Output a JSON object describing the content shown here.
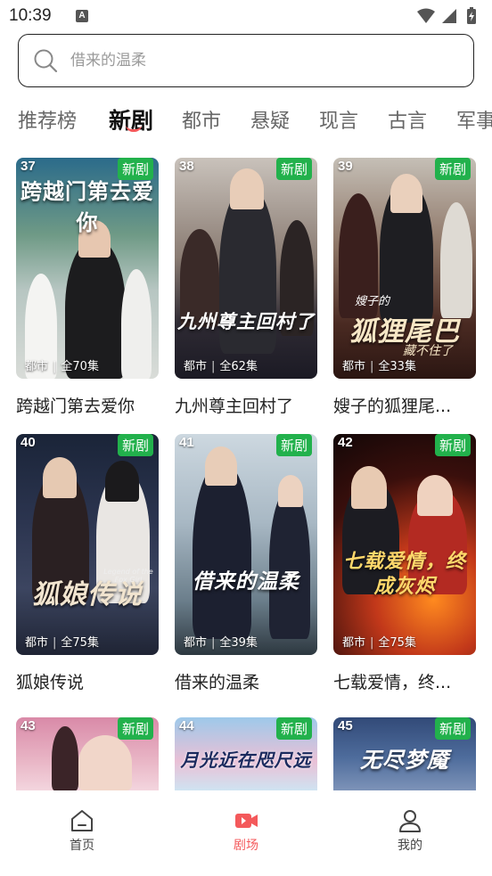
{
  "status": {
    "time": "10:39",
    "a_icon": "A"
  },
  "search": {
    "placeholder": "借来的温柔"
  },
  "tabs": [
    {
      "label": "推荐榜",
      "active": false
    },
    {
      "label": "新剧",
      "active": true
    },
    {
      "label": "都市",
      "active": false
    },
    {
      "label": "悬疑",
      "active": false
    },
    {
      "label": "现言",
      "active": false
    },
    {
      "label": "古言",
      "active": false
    },
    {
      "label": "军事",
      "active": false
    }
  ],
  "cards": [
    {
      "num": "37",
      "badge": "新剧",
      "poster_title": "跨越门第去爱你",
      "genre": "都市",
      "episodes": "全70集",
      "title": "跨越门第去爱你"
    },
    {
      "num": "38",
      "badge": "新剧",
      "poster_title": "九州尊主回村了",
      "genre": "都市",
      "episodes": "全62集",
      "title": "九州尊主回村了"
    },
    {
      "num": "39",
      "badge": "新剧",
      "poster_title": "狐狸尾巴",
      "poster_small": "嫂子的",
      "poster_sub": "藏不住了",
      "genre": "都市",
      "episodes": "全33集",
      "title": "嫂子的狐狸尾..."
    },
    {
      "num": "40",
      "badge": "新剧",
      "poster_title": "狐娘传说",
      "poster_sub": "Legend of the Fox Girl",
      "genre": "都市",
      "episodes": "全75集",
      "title": "狐娘传说"
    },
    {
      "num": "41",
      "badge": "新剧",
      "poster_title": "借来的温柔",
      "genre": "都市",
      "episodes": "全39集",
      "title": "借来的温柔"
    },
    {
      "num": "42",
      "badge": "新剧",
      "poster_title": "七载爱情，终成灰烬",
      "genre": "都市",
      "episodes": "全75集",
      "title": "七载爱情，终..."
    },
    {
      "num": "43",
      "badge": "新剧",
      "poster_title": "",
      "genre": "",
      "episodes": "",
      "title": ""
    },
    {
      "num": "44",
      "badge": "新剧",
      "poster_title": "月光近在咫尺远",
      "genre": "",
      "episodes": "",
      "title": ""
    },
    {
      "num": "45",
      "badge": "新剧",
      "poster_title": "无尽梦魇",
      "genre": "",
      "episodes": "",
      "title": ""
    }
  ],
  "nav": [
    {
      "label": "首页",
      "icon": "home-icon",
      "active": false
    },
    {
      "label": "剧场",
      "icon": "video-icon",
      "active": true
    },
    {
      "label": "我的",
      "icon": "user-icon",
      "active": false
    }
  ],
  "colors": {
    "accent": "#f4595b",
    "badge_green": "#22b14c"
  }
}
